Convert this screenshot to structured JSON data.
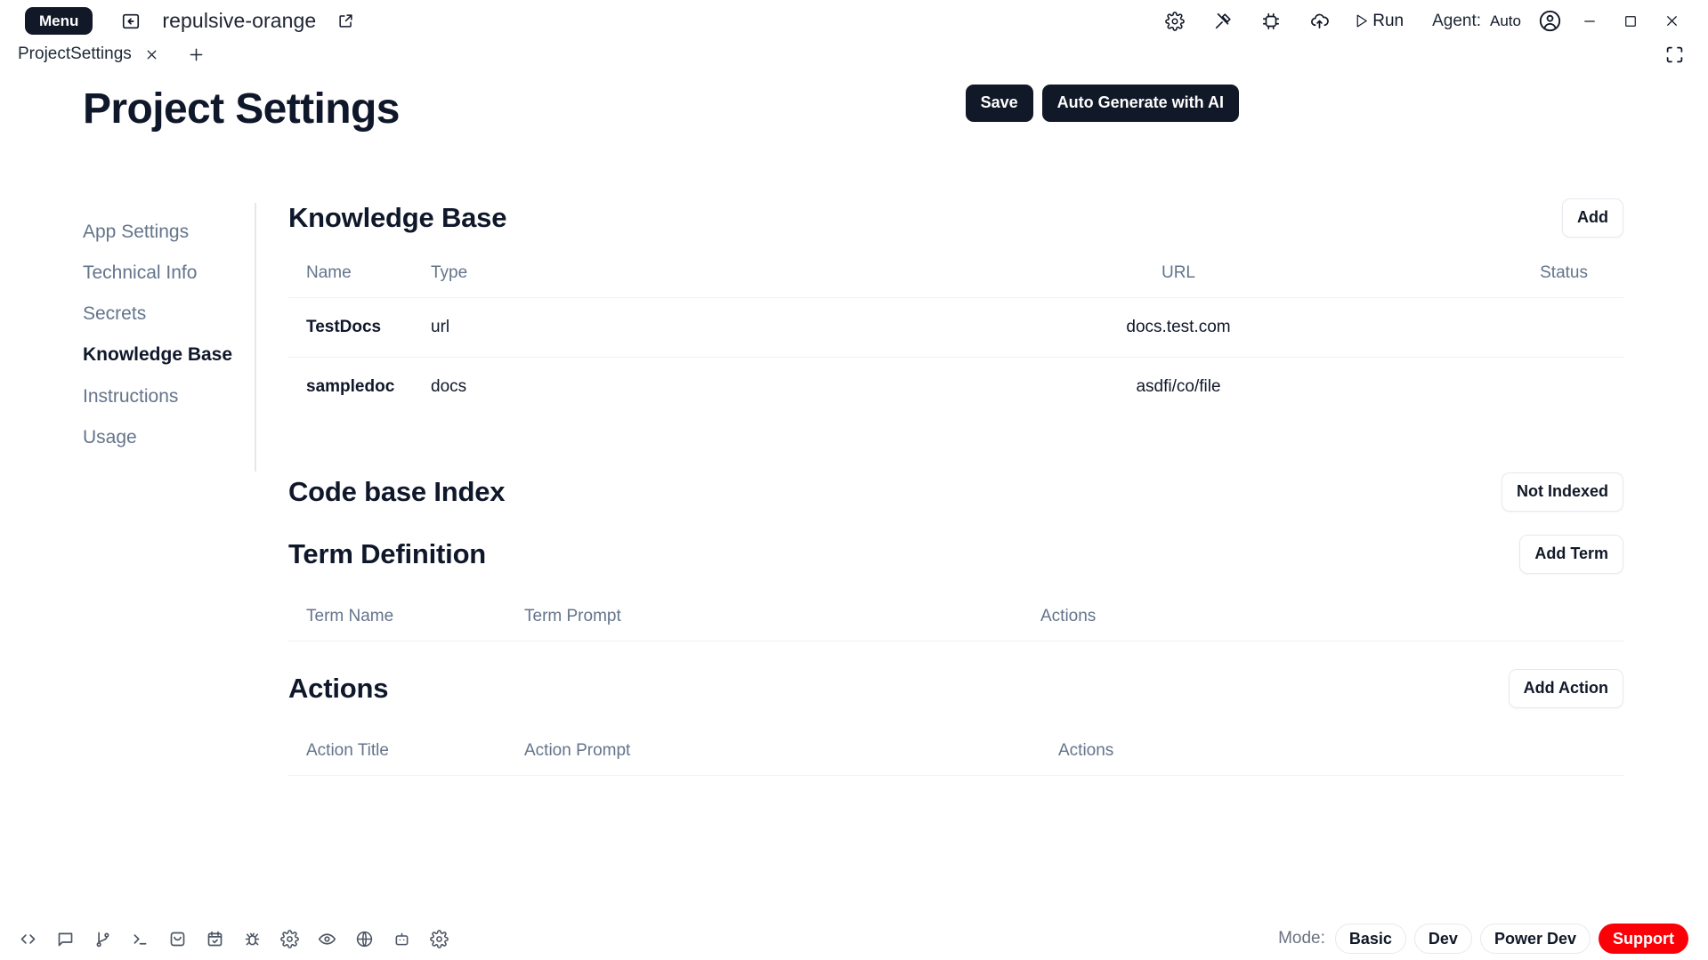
{
  "titlebar": {
    "menu_label": "Menu",
    "back_icon": "back-arrow-icon",
    "project_name": "repulsive-orange",
    "external_icon": "external-link-icon",
    "tools": [
      {
        "icon": "gear-icon",
        "name": "settings-icon"
      },
      {
        "icon": "hammer-icon",
        "name": "build-tool-icon"
      },
      {
        "icon": "extensions-icon",
        "name": "extensions-icon"
      },
      {
        "icon": "cloud-upload-icon",
        "name": "cloud-upload-icon"
      }
    ],
    "run_label": "Run",
    "run_icon": "play-icon",
    "agent_label": "Agent:",
    "agent_value": "Auto",
    "account_icon": "account-avatar-icon",
    "window_minimize": "minimize-icon",
    "window_maximize": "maximize-icon",
    "window_close": "close-icon"
  },
  "tabbar": {
    "tab_label": "ProjectSettings",
    "close_icon": "close-icon",
    "add_icon": "plus-icon",
    "fullscreen_icon": "fullscreen-icon"
  },
  "header": {
    "title": "Project Settings",
    "save_label": "Save",
    "autogen_label": "Auto Generate with AI"
  },
  "sidebar": {
    "items": [
      {
        "label": "App Settings",
        "active": false
      },
      {
        "label": "Technical Info",
        "active": false
      },
      {
        "label": "Secrets",
        "active": false
      },
      {
        "label": "Knowledge Base",
        "active": true
      },
      {
        "label": "Instructions",
        "active": false
      },
      {
        "label": "Usage",
        "active": false
      }
    ]
  },
  "knowledge_base": {
    "title": "Knowledge Base",
    "add_label": "Add",
    "columns": [
      "Name",
      "Type",
      "URL",
      "Status"
    ],
    "rows": [
      {
        "name": "TestDocs",
        "type": "url",
        "url": "docs.test.com",
        "status": ""
      },
      {
        "name": "sampledoc",
        "type": "docs",
        "url": "asdfi/co/file",
        "status": ""
      }
    ]
  },
  "codebase_index": {
    "title": "Code base Index",
    "status_label": "Not Indexed"
  },
  "term_definition": {
    "title": "Term Definition",
    "add_label": "Add Term",
    "columns": [
      "Term Name",
      "Term Prompt",
      "Actions"
    ],
    "rows": []
  },
  "actions_section": {
    "title": "Actions",
    "add_label": "Add Action",
    "columns": [
      "Action Title",
      "Action Prompt",
      "Actions"
    ],
    "rows": []
  },
  "statusbar": {
    "icons": [
      "code-brackets-icon",
      "chat-bubble-icon",
      "git-branch-icon",
      "terminal-icon",
      "inbox-icon",
      "calendar-check-icon",
      "bug-icon",
      "gear-icon",
      "eye-icon",
      "globe-icon",
      "robot-icon",
      "gear-icon"
    ],
    "mode_label": "Mode:",
    "modes": [
      "Basic",
      "Dev",
      "Power Dev"
    ],
    "support_label": "Support"
  },
  "colors": {
    "accent_dark": "#111827",
    "support_red": "#fb0007",
    "muted_text": "#64748b",
    "border": "#e5e9f0"
  }
}
